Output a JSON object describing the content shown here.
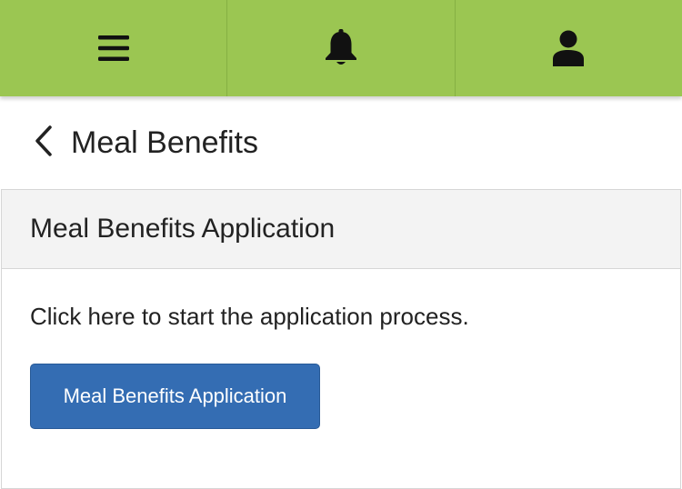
{
  "topbar": {
    "background_color": "#9bc652",
    "icons": [
      "hamburger-menu-icon",
      "bell-icon",
      "user-profile-icon"
    ]
  },
  "header": {
    "back_icon": "chevron-left-icon",
    "title": "Meal Benefits"
  },
  "panel": {
    "heading": "Meal Benefits Application",
    "description": "Click here to start the application process.",
    "button_label": "Meal Benefits Application",
    "button_color": "#346db3"
  }
}
